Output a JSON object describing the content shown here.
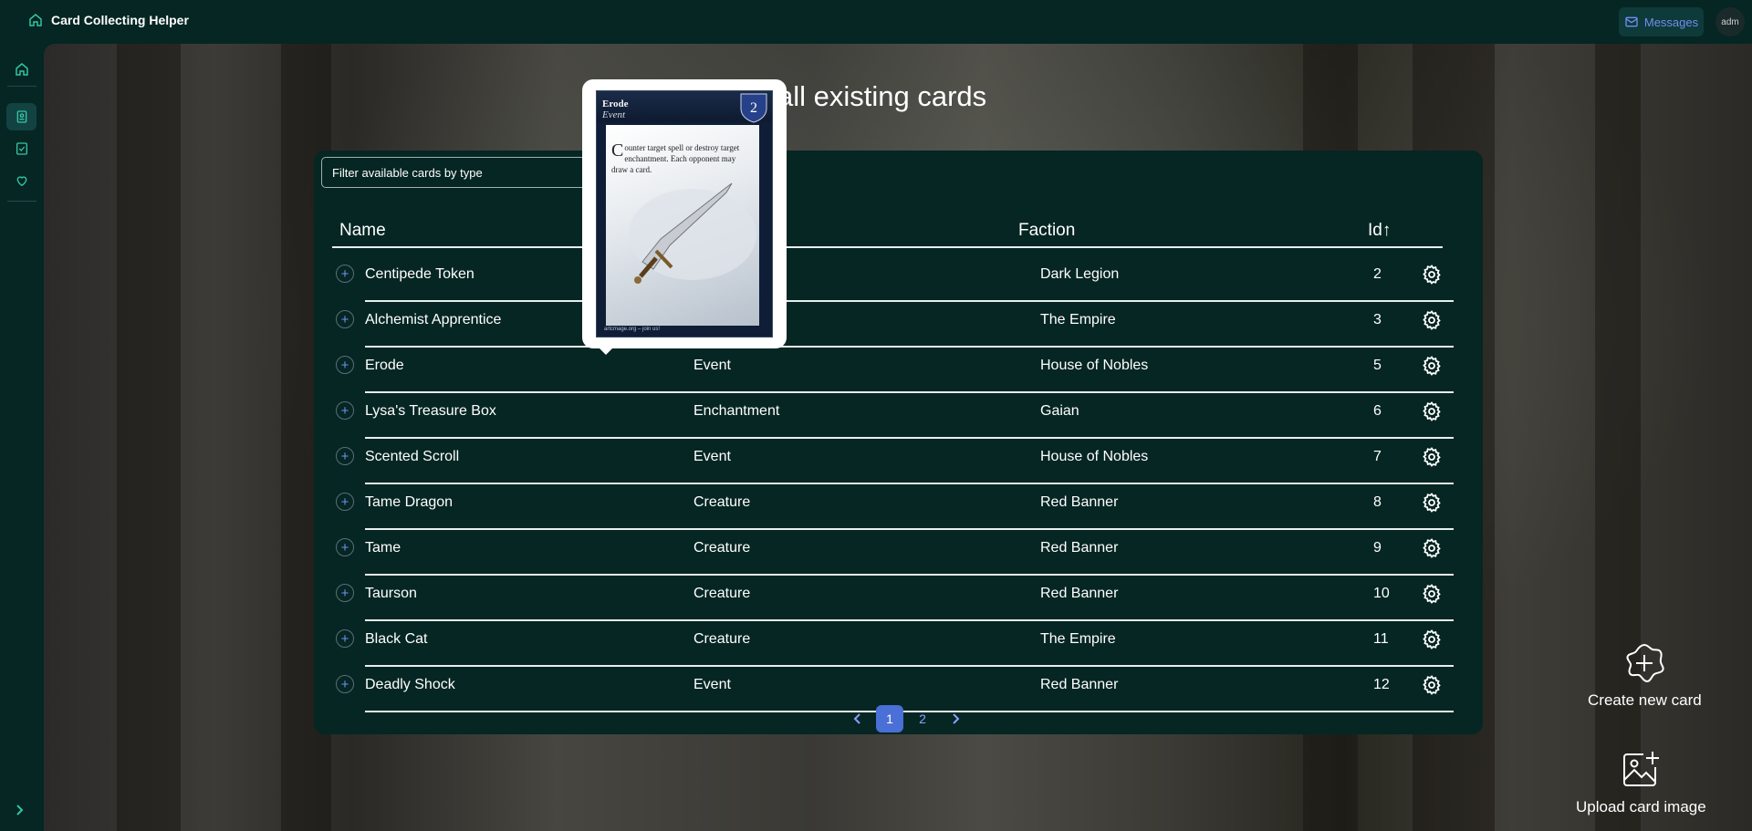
{
  "app": {
    "title": "Card Collecting Helper"
  },
  "header": {
    "messages_label": "Messages",
    "avatar_text": "adm"
  },
  "page": {
    "title": "Browse all existing cards"
  },
  "filter": {
    "placeholder": "Filter available cards by type"
  },
  "table": {
    "columns": {
      "name": "Name",
      "faction": "Faction",
      "id": "Id↑"
    },
    "rows": [
      {
        "name": "Centipede Token",
        "type": "",
        "faction": "Dark Legion",
        "id": "2"
      },
      {
        "name": "Alchemist Apprentice",
        "type": "",
        "faction": "The Empire",
        "id": "3"
      },
      {
        "name": "Erode",
        "type": "Event",
        "faction": "House of Nobles",
        "id": "5"
      },
      {
        "name": "Lysa's Treasure Box",
        "type": "Enchantment",
        "faction": "Gaian",
        "id": "6"
      },
      {
        "name": "Scented Scroll",
        "type": "Event",
        "faction": "House of Nobles",
        "id": "7"
      },
      {
        "name": "Tame Dragon",
        "type": "Creature",
        "faction": "Red Banner",
        "id": "8"
      },
      {
        "name": "Tame",
        "type": "Creature",
        "faction": "Red Banner",
        "id": "9"
      },
      {
        "name": "Taurson",
        "type": "Creature",
        "faction": "Red Banner",
        "id": "10"
      },
      {
        "name": "Black Cat",
        "type": "Creature",
        "faction": "The Empire",
        "id": "11"
      },
      {
        "name": "Deadly Shock",
        "type": "Event",
        "faction": "Red Banner",
        "id": "12"
      }
    ]
  },
  "pagination": {
    "pages": [
      "1",
      "2"
    ],
    "current": "1"
  },
  "preview_card": {
    "name": "Erode",
    "type": "Event",
    "cost": "2",
    "text_cap": "C",
    "text_rest": "ounter target spell or destroy target enchantment. Each opponent may draw a card.",
    "footer": "artcmage.org – join us!"
  },
  "actions": {
    "create_label": "Create new card",
    "upload_label": "Upload card image"
  },
  "colors": {
    "accent": "#4a6fd6",
    "brand_icon": "#34c6a3",
    "panel": "#052623"
  }
}
